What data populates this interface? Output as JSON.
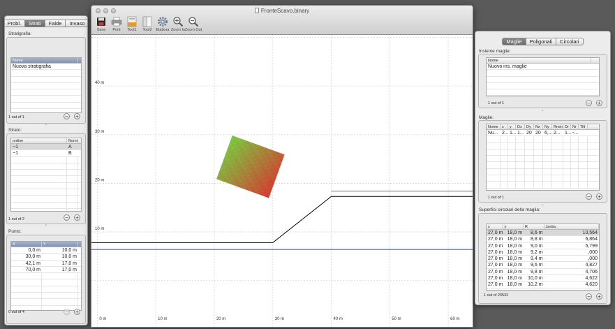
{
  "window": {
    "title": "FronteScavo.binary",
    "toolbar": [
      {
        "id": "save",
        "label": "Save",
        "icon": "floppy-disk-icon"
      },
      {
        "id": "print",
        "label": "Print",
        "icon": "printer-icon"
      },
      {
        "id": "tool1",
        "label": "Tool1",
        "icon": "folder-icon"
      },
      {
        "id": "tool2",
        "label": "Tool2",
        "icon": "panel-icon"
      },
      {
        "id": "elabora",
        "label": "Elabora",
        "icon": "gear-icon"
      },
      {
        "id": "zoom_in",
        "label": "Zoom In",
        "icon": "zoom-in-icon"
      },
      {
        "id": "zoom_out",
        "label": "Zoom Out",
        "icon": "zoom-out-icon"
      }
    ]
  },
  "left_panel": {
    "tabs": [
      "Probl.",
      "Strati",
      "Falde",
      "Invaso"
    ],
    "active_tab": "Strati",
    "stratigrafia": {
      "label": "Stratigrafia:",
      "columns": [
        "Nome"
      ],
      "rows": [
        [
          "Nuova stratigrafia"
        ]
      ],
      "footer": "1 out of 1"
    },
    "strato": {
      "label": "Strato:",
      "columns": [
        "ordine",
        "Nome"
      ],
      "rows": [
        [
          "−1",
          "A"
        ],
        [
          "−1",
          "B"
        ]
      ],
      "footer": "1 out of 2"
    },
    "punto": {
      "label": "Punto:",
      "columns": [
        "X",
        "Y"
      ],
      "rows": [
        [
          "0,0 m",
          "10,0 m"
        ],
        [
          "30,0 m",
          "10,0 m"
        ],
        [
          "42,1 m",
          "17,0 m"
        ],
        [
          "70,0 m",
          "17,0 m"
        ]
      ],
      "footer": "0 out of 4"
    }
  },
  "right_panel": {
    "tabs": [
      "Maglie",
      "Poligonali",
      "Circolari"
    ],
    "active_tab": "Maglie",
    "insieme": {
      "label": "Insieme maglie:",
      "columns": [
        "Nome"
      ],
      "rows": [
        [
          "Nuovo ins. maglie"
        ]
      ],
      "footer": "1 out of 1"
    },
    "maglie": {
      "label": "Maglie:",
      "columns": [
        "Nome",
        "x",
        "y",
        "Dx",
        "Dy",
        "Nx",
        "Ny",
        "Rmin",
        "Dr",
        "Nr",
        "Tilt"
      ],
      "rows": [
        [
          "Nu...",
          "2...",
          "1...",
          "1...",
          "20",
          "20",
          "6,...",
          "2...",
          "1...",
          "-..."
        ]
      ],
      "footer": "1 out of 1"
    },
    "superfici": {
      "label": "Superfici circolari della maglia:",
      "columns": [
        "x",
        "y",
        "R",
        "Janbu"
      ],
      "rows": [
        [
          "27,0 m",
          "18,0 m",
          "8,6 m",
          "10,564"
        ],
        [
          "27,0 m",
          "18,0 m",
          "8,8 m",
          "6,864"
        ],
        [
          "27,0 m",
          "18,0 m",
          "9,0 m",
          "5,799"
        ],
        [
          "27,0 m",
          "18,0 m",
          "9,2 m",
          ",000"
        ],
        [
          "27,0 m",
          "18,0 m",
          "9,4 m",
          ",000"
        ],
        [
          "27,0 m",
          "18,0 m",
          "9,6 m",
          "4,827"
        ],
        [
          "27,0 m",
          "18,0 m",
          "9,8 m",
          "4,706"
        ],
        [
          "27,0 m",
          "18,0 m",
          "10,0 m",
          "4,622"
        ],
        [
          "27,0 m",
          "18,0 m",
          "10,2 m",
          "4,620"
        ]
      ],
      "footer": "1 out of 23532"
    }
  },
  "chart_data": {
    "type": "line",
    "x_ticks": [
      "0 m",
      "10 m",
      "20 m",
      "30 m",
      "40 m",
      "50 m",
      "60 m"
    ],
    "y_ticks": [
      "10 m",
      "20 m",
      "30 m",
      "40 m"
    ],
    "xlim": [
      -1,
      64.4
    ],
    "ylim": [
      -9.8,
      50.5
    ],
    "grid": true,
    "series": [
      {
        "color": "#000000",
        "x": [
          -1,
          30,
          40,
          64.4
        ],
        "y": [
          7.8,
          7.8,
          17.3,
          17.3
        ]
      },
      {
        "color": "#e04040",
        "x": [
          40,
          64.4
        ],
        "y": [
          18.4,
          18.4
        ]
      },
      {
        "color": "#2040e0",
        "x": [
          -1,
          64.4
        ],
        "y": [
          6.4,
          6.4
        ]
      }
    ],
    "mesh": {
      "center_x": 26.2,
      "center_y": 23.4,
      "size_x": 9.5,
      "size_y": 9.5,
      "tilt_deg": 20,
      "color_low": "#d93b2e",
      "color_high": "#7ccc3c"
    }
  }
}
